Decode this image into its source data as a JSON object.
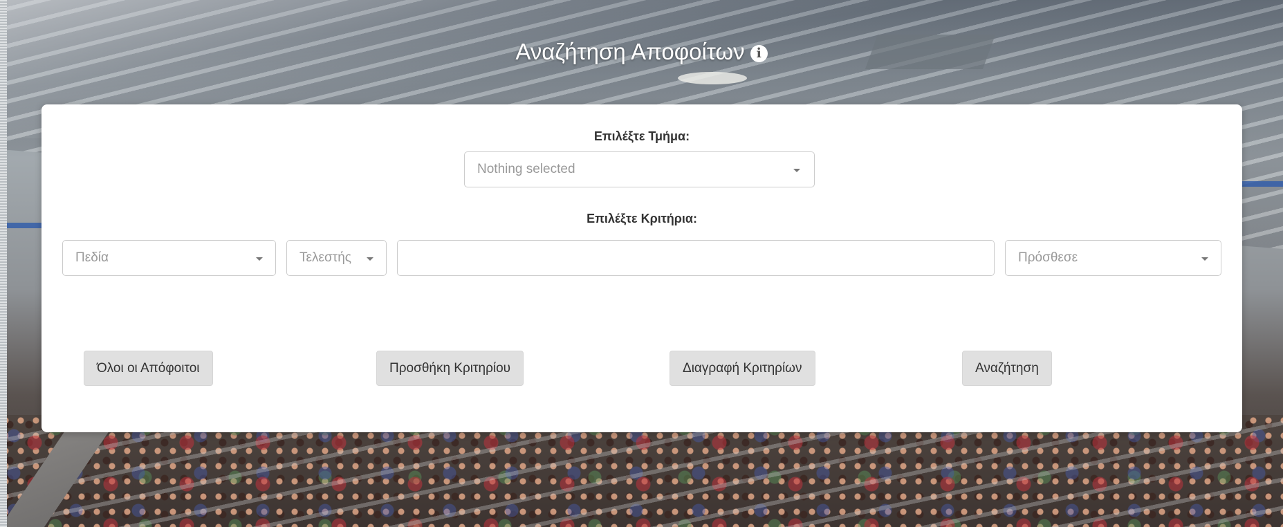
{
  "page": {
    "title": "Αναζήτηση Αποφοίτων",
    "info_icon": "info-circle-icon"
  },
  "department": {
    "label": "Επιλέξτε Τμήμα:",
    "select_value": "Nothing selected"
  },
  "criteria": {
    "label": "Επιλέξτε Κριτήρια:",
    "field_select": "Πεδία",
    "operator_select": "Τελεστής",
    "value_input": "",
    "add_select": "Πρόσθεσε"
  },
  "buttons": {
    "all_graduates": "Όλοι οι Απόφοιτοι",
    "add_criterion": "Προσθήκη Κριτηρίου",
    "delete_criteria": "Διαγραφή Κριτηρίων",
    "search": "Αναζήτηση"
  },
  "colors": {
    "card_background": "#ffffff",
    "button_background": "#e0e0e0",
    "title_text": "#ffffff"
  }
}
